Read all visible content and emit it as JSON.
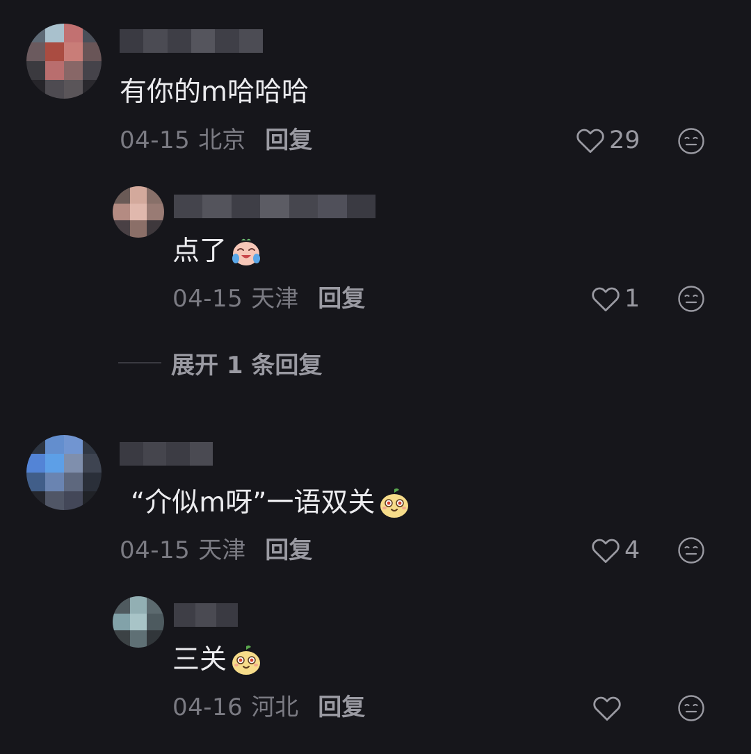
{
  "colors": {
    "background": "#16161b",
    "primary_text": "#ececef",
    "secondary_text": "#7b7b83",
    "action_text": "#9a9aa2"
  },
  "comments": [
    {
      "text": "有你的m哈哈哈",
      "date": "04-15",
      "location": "北京",
      "reply_label": "回复",
      "likes": "29",
      "emoji": null
    },
    {
      "text": "点了",
      "date": "04-15",
      "location": "天津",
      "reply_label": "回复",
      "likes": "1",
      "emoji": "crying-laugh-emoji"
    },
    {
      "text": "“介似m呀”一语双关",
      "date": "04-15",
      "location": "天津",
      "reply_label": "回复",
      "likes": "4",
      "emoji": "smug-bean-emoji"
    },
    {
      "text": "三关",
      "date": "04-16",
      "location": "河北",
      "reply_label": "回复",
      "likes": "",
      "emoji": "smug-bean-emoji"
    }
  ],
  "expand_replies": {
    "label": "展开 1 条回复"
  },
  "icons": {
    "like": "heart-outline-icon",
    "react": "emoji-face-icon"
  }
}
